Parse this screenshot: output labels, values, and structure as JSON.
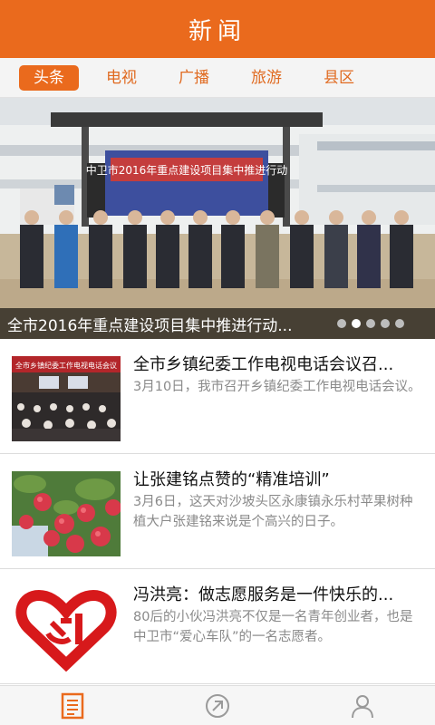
{
  "header": {
    "title": "新闻"
  },
  "tabs": [
    {
      "label": "头条",
      "active": true
    },
    {
      "label": "电视",
      "active": false
    },
    {
      "label": "广播",
      "active": false
    },
    {
      "label": "旅游",
      "active": false
    },
    {
      "label": "县区",
      "active": false
    }
  ],
  "banner": {
    "caption": "全市2016年重点建设项目集中推进行动...",
    "stage_banner_text": "中卫市2016年重点建设项目集中推进行动",
    "slide_count": 5,
    "active_slide": 2
  },
  "news": [
    {
      "title": "全市乡镇纪委工作电视电话会议召...",
      "summary": "3月10日，我市召开乡镇纪委工作电视电话会议。",
      "thumb_screen_text": "全市乡镇纪委工作电视电话会议"
    },
    {
      "title": "让张建铭点赞的“精准培训”",
      "summary": "3月6日，这天对沙坡头区永康镇永乐村苹果树种植大户张建铭来说是个高兴的日子。"
    },
    {
      "title": "冯洪亮：做志愿服务是一件快乐的...",
      "summary": "80后的小伙冯洪亮不仅是一名青年创业者，也是中卫市“爱心车队”的一名志愿者。"
    }
  ],
  "bottom_nav": [
    {
      "icon": "news-icon",
      "active": true
    },
    {
      "icon": "video-icon",
      "active": false
    },
    {
      "icon": "user-icon",
      "active": false
    }
  ],
  "colors": {
    "accent": "#ea6a1d",
    "party_red": "#d7191b"
  }
}
